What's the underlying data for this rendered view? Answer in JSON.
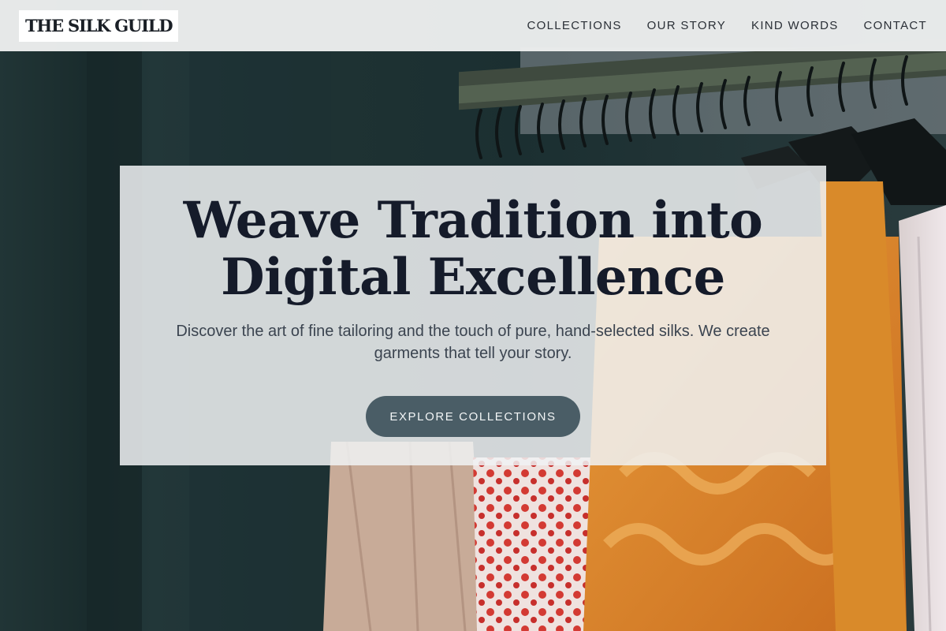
{
  "header": {
    "logo": "THE SILK GUILD",
    "nav": [
      {
        "label": "COLLECTIONS"
      },
      {
        "label": "OUR STORY"
      },
      {
        "label": "KIND WORDS"
      },
      {
        "label": "CONTACT"
      }
    ]
  },
  "hero": {
    "title_line_1": "Weave Tradition into",
    "title_line_2": "Digital Excellence",
    "subtitle": "Discover the art of fine tailoring and the touch of pure, hand-selected silks. We create garments that tell your story.",
    "cta_label": "EXPLORE COLLECTIONS",
    "background_image": "clothing-rack-photo"
  },
  "colors": {
    "header_bg": "#eceeee",
    "title": "#151b2a",
    "subtitle": "#3b4450",
    "cta_bg": "#4a5d66",
    "cta_text": "#f2f5f6",
    "wall": "#1c2f30"
  }
}
